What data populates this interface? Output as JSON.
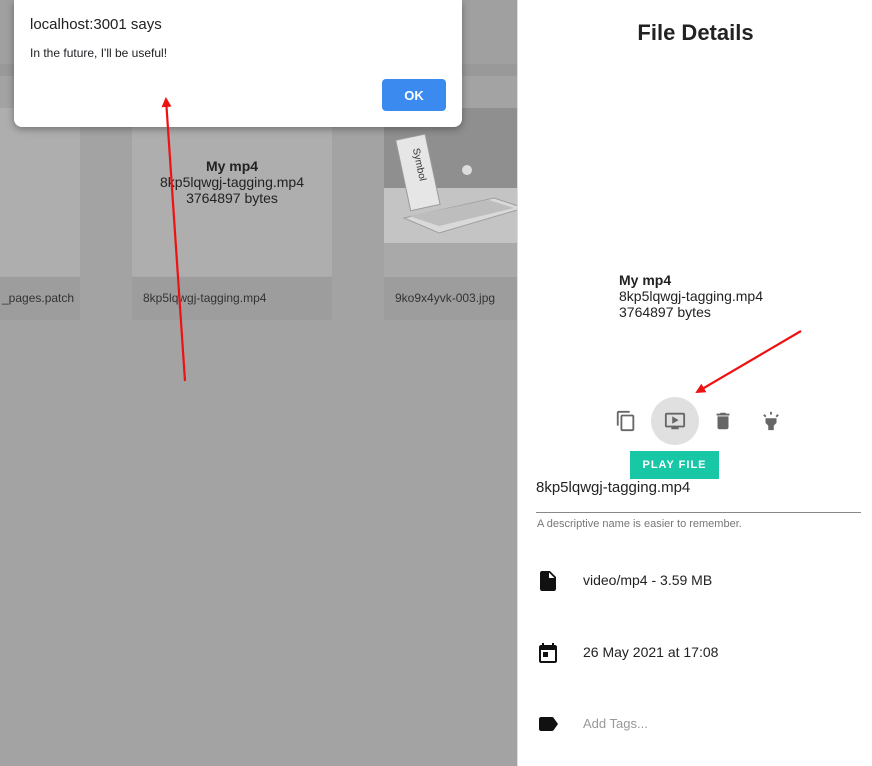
{
  "alert": {
    "title": "localhost:3001 says",
    "message": "In the future, I'll be useful!",
    "ok_label": "OK"
  },
  "grid": {
    "cards": [
      {
        "caption": "_pages.patch"
      },
      {
        "title": "My mp4",
        "filename": "8kp5lqwgj-tagging.mp4",
        "size": "3764897 bytes",
        "caption": "8kp5lqwgj-tagging.mp4"
      },
      {
        "caption": "9ko9x4yvk-003.jpg",
        "image_label": "Symbol"
      }
    ]
  },
  "details": {
    "title": "File Details",
    "file_title": "My mp4",
    "filename": "8kp5lqwgj-tagging.mp4",
    "size": "3764897 bytes",
    "actions": [
      {
        "icon": "copy-icon"
      },
      {
        "icon": "play-file-icon",
        "active": true
      },
      {
        "icon": "delete-icon"
      },
      {
        "icon": "flashlight-icon"
      }
    ],
    "tooltip": "PLAY FILE",
    "name_value": "8kp5lqwgj-tagging.mp4",
    "name_hint": "A descriptive name is easier to remember.",
    "type_info": "video/mp4 - 3.59 MB",
    "date": "26 May 2021 at 17:08",
    "tags_placeholder": "Add Tags..."
  },
  "colors": {
    "accent_tooltip": "#18c7a6",
    "ok_button": "#3b8af0",
    "annotation_arrow": "#ee1111"
  }
}
